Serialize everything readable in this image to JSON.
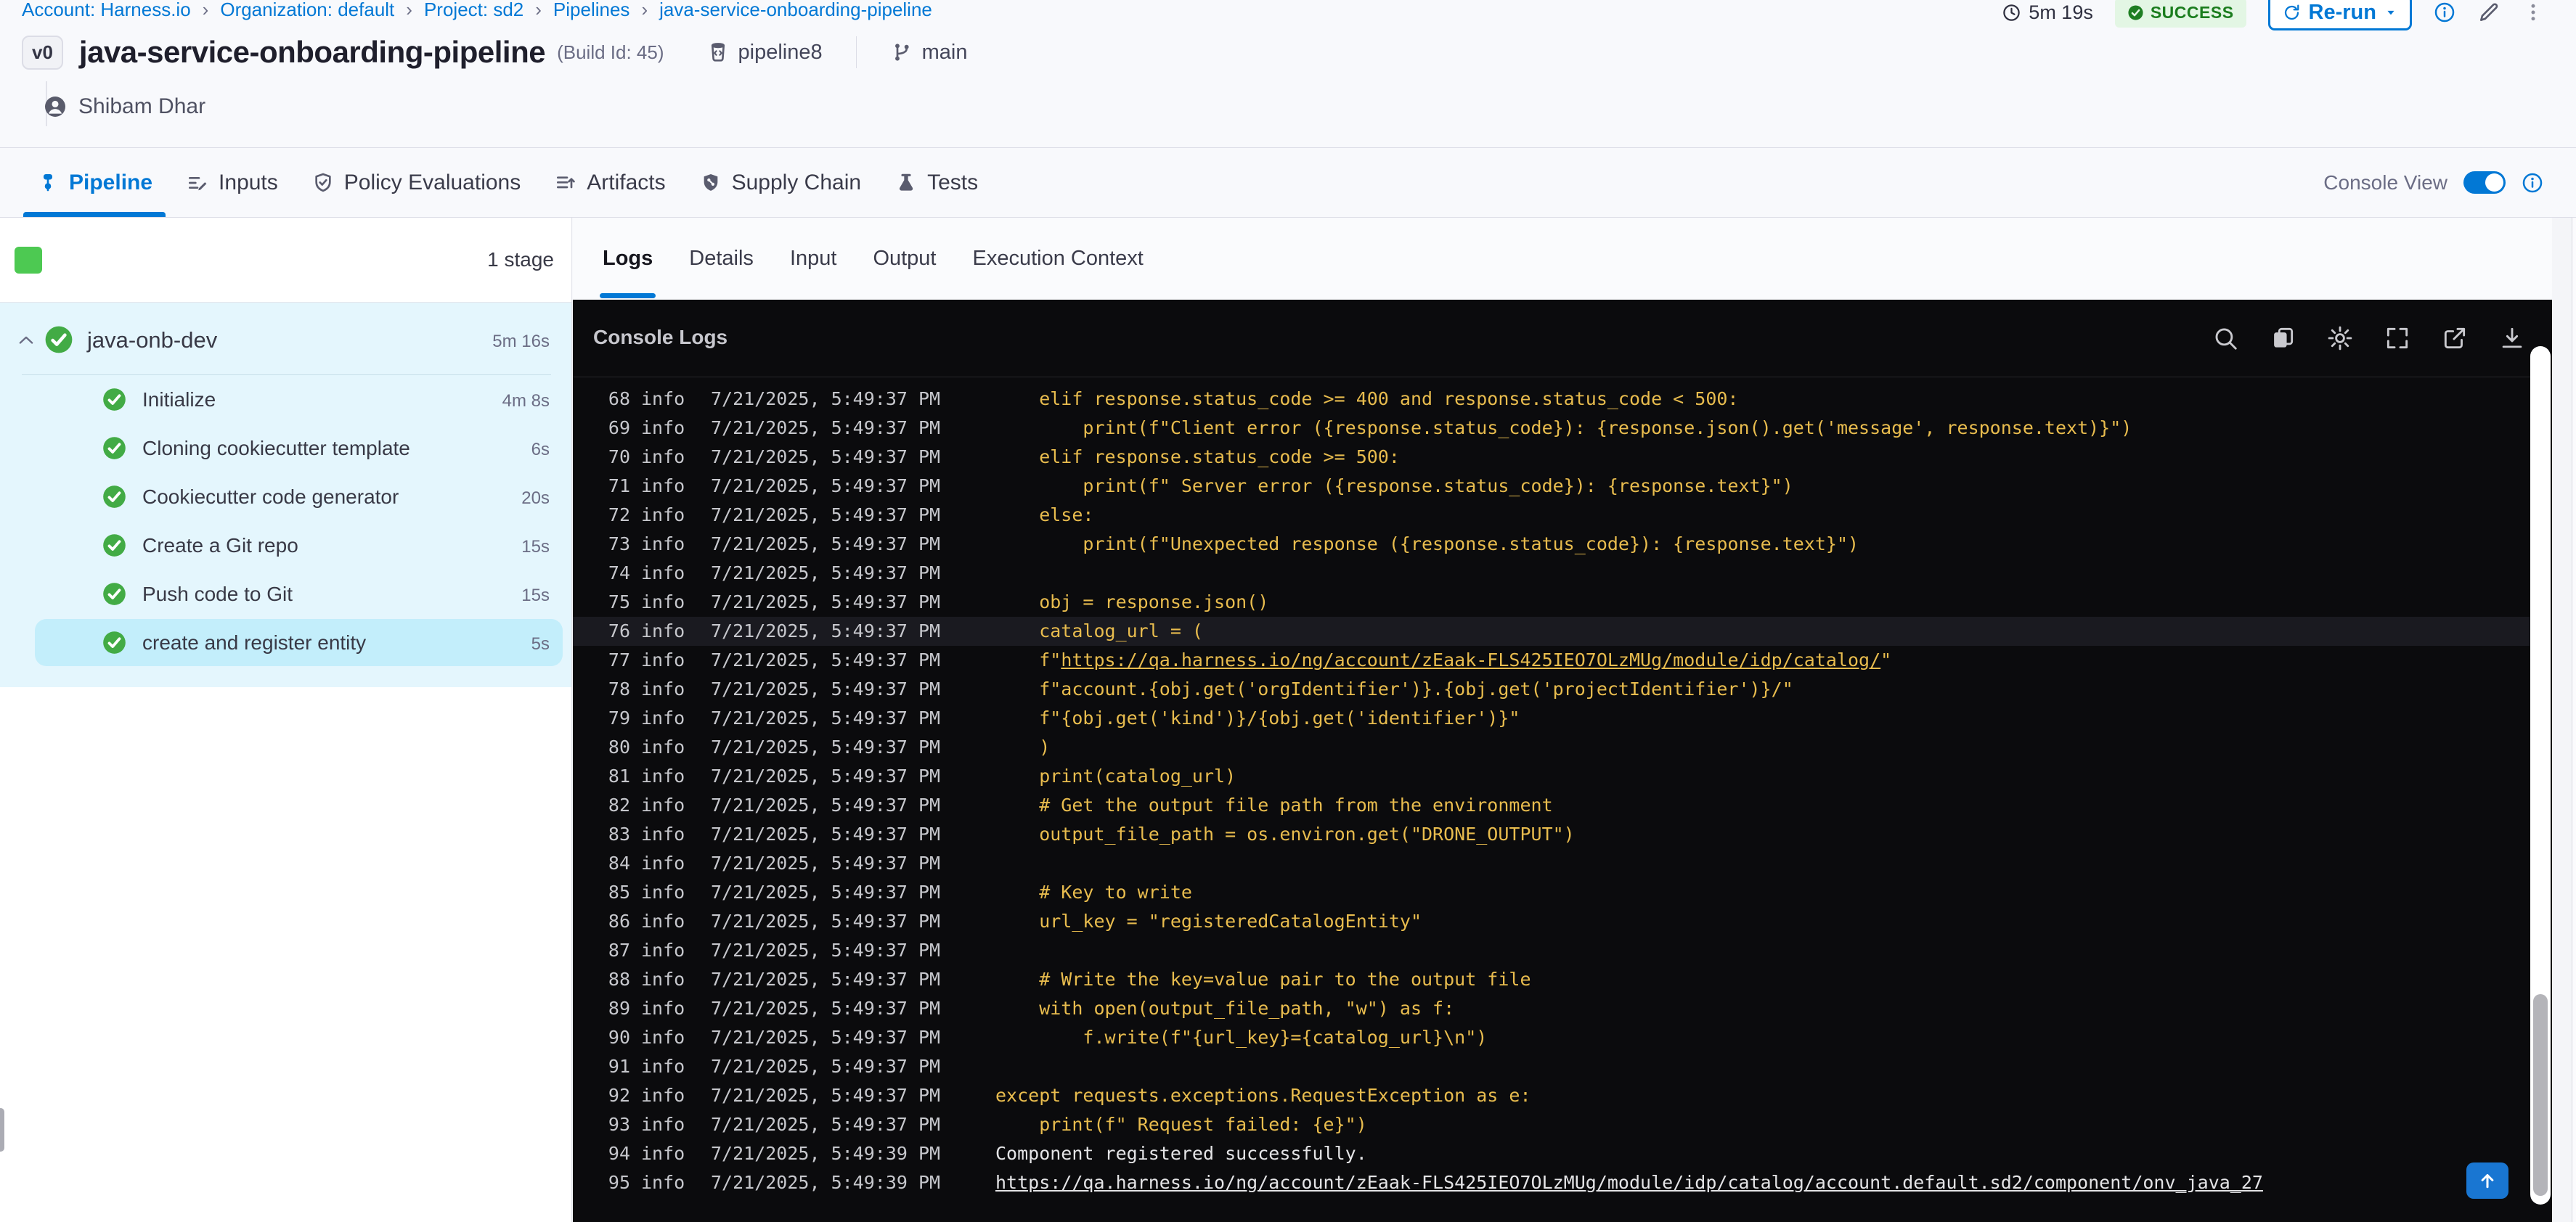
{
  "breadcrumb": {
    "items": [
      "Account: Harness.io",
      "Organization: default",
      "Project: sd2",
      "Pipelines",
      "java-service-onboarding-pipeline"
    ]
  },
  "run_meta": {
    "duration": "5m 19s",
    "status": "SUCCESS",
    "rerun_label": "Re-run"
  },
  "pipeline_header": {
    "version_chip": "v0",
    "title": "java-service-onboarding-pipeline",
    "build_label": "(Build Id: 45)",
    "repo": "pipeline8",
    "branch": "main",
    "user": "Shibam Dhar"
  },
  "nav_tabs": [
    {
      "label": "Pipeline",
      "icon": "pipeline-icon",
      "active": true
    },
    {
      "label": "Inputs",
      "icon": "inputs-icon",
      "active": false
    },
    {
      "label": "Policy Evaluations",
      "icon": "policy-icon",
      "active": false
    },
    {
      "label": "Artifacts",
      "icon": "artifacts-icon",
      "active": false
    },
    {
      "label": "Supply Chain",
      "icon": "supply-chain-icon",
      "active": false
    },
    {
      "label": "Tests",
      "icon": "tests-icon",
      "active": false
    }
  ],
  "console_view": {
    "label": "Console View",
    "enabled": true
  },
  "stage_panel": {
    "count_label": "1 stage",
    "stage": {
      "name": "java-onb-dev",
      "duration": "5m 16s"
    },
    "steps": [
      {
        "name": "Initialize",
        "duration": "4m 8s",
        "selected": false
      },
      {
        "name": "Cloning cookiecutter template",
        "duration": "6s",
        "selected": false
      },
      {
        "name": "Cookiecutter code generator",
        "duration": "20s",
        "selected": false
      },
      {
        "name": "Create a Git repo",
        "duration": "15s",
        "selected": false
      },
      {
        "name": "Push code to Git",
        "duration": "15s",
        "selected": false
      },
      {
        "name": "create and register entity",
        "duration": "5s",
        "selected": true
      }
    ]
  },
  "detail_tabs": [
    {
      "label": "Logs",
      "active": true
    },
    {
      "label": "Details",
      "active": false
    },
    {
      "label": "Input",
      "active": false
    },
    {
      "label": "Output",
      "active": false
    },
    {
      "label": "Execution Context",
      "active": false
    }
  ],
  "console": {
    "title": "Console Logs",
    "toolbar": [
      "search",
      "copy",
      "settings",
      "fullscreen",
      "open-in-new",
      "download"
    ],
    "lines": [
      {
        "n": 68,
        "level": "info",
        "ts": "7/21/2025, 5:49:37 PM",
        "style": "code",
        "text": "    elif response.status_code >= 400 and response.status_code < 500:"
      },
      {
        "n": 69,
        "level": "info",
        "ts": "7/21/2025, 5:49:37 PM",
        "style": "code",
        "text": "        print(f\"Client error ({response.status_code}): {response.json().get('message', response.text)}\")"
      },
      {
        "n": 70,
        "level": "info",
        "ts": "7/21/2025, 5:49:37 PM",
        "style": "code",
        "text": "    elif response.status_code >= 500:"
      },
      {
        "n": 71,
        "level": "info",
        "ts": "7/21/2025, 5:49:37 PM",
        "style": "code",
        "text": "        print(f\" Server error ({response.status_code}): {response.text}\")"
      },
      {
        "n": 72,
        "level": "info",
        "ts": "7/21/2025, 5:49:37 PM",
        "style": "code",
        "text": "    else:"
      },
      {
        "n": 73,
        "level": "info",
        "ts": "7/21/2025, 5:49:37 PM",
        "style": "code",
        "text": "        print(f\"Unexpected response ({response.status_code}): {response.text}\")"
      },
      {
        "n": 74,
        "level": "info",
        "ts": "7/21/2025, 5:49:37 PM",
        "style": "code",
        "text": ""
      },
      {
        "n": 75,
        "level": "info",
        "ts": "7/21/2025, 5:49:37 PM",
        "style": "code",
        "text": "    obj = response.json()"
      },
      {
        "n": 76,
        "level": "info",
        "ts": "7/21/2025, 5:49:37 PM",
        "style": "code",
        "text": "    catalog_url = (",
        "highlight": true
      },
      {
        "n": 77,
        "level": "info",
        "ts": "7/21/2025, 5:49:37 PM",
        "style": "code",
        "text": "    f\"",
        "link": "https://qa.harness.io/ng/account/zEaak-FLS425IEO7OLzMUg/module/idp/catalog/",
        "tail": "\""
      },
      {
        "n": 78,
        "level": "info",
        "ts": "7/21/2025, 5:49:37 PM",
        "style": "code",
        "text": "    f\"account.{obj.get('orgIdentifier')}.{obj.get('projectIdentifier')}/\""
      },
      {
        "n": 79,
        "level": "info",
        "ts": "7/21/2025, 5:49:37 PM",
        "style": "code",
        "text": "    f\"{obj.get('kind')}/{obj.get('identifier')}\""
      },
      {
        "n": 80,
        "level": "info",
        "ts": "7/21/2025, 5:49:37 PM",
        "style": "code",
        "text": "    )"
      },
      {
        "n": 81,
        "level": "info",
        "ts": "7/21/2025, 5:49:37 PM",
        "style": "code",
        "text": "    print(catalog_url)"
      },
      {
        "n": 82,
        "level": "info",
        "ts": "7/21/2025, 5:49:37 PM",
        "style": "code",
        "text": "    # Get the output file path from the environment"
      },
      {
        "n": 83,
        "level": "info",
        "ts": "7/21/2025, 5:49:37 PM",
        "style": "code",
        "text": "    output_file_path = os.environ.get(\"DRONE_OUTPUT\")"
      },
      {
        "n": 84,
        "level": "info",
        "ts": "7/21/2025, 5:49:37 PM",
        "style": "code",
        "text": ""
      },
      {
        "n": 85,
        "level": "info",
        "ts": "7/21/2025, 5:49:37 PM",
        "style": "code",
        "text": "    # Key to write"
      },
      {
        "n": 86,
        "level": "info",
        "ts": "7/21/2025, 5:49:37 PM",
        "style": "code",
        "text": "    url_key = \"registeredCatalogEntity\""
      },
      {
        "n": 87,
        "level": "info",
        "ts": "7/21/2025, 5:49:37 PM",
        "style": "code",
        "text": ""
      },
      {
        "n": 88,
        "level": "info",
        "ts": "7/21/2025, 5:49:37 PM",
        "style": "code",
        "text": "    # Write the key=value pair to the output file"
      },
      {
        "n": 89,
        "level": "info",
        "ts": "7/21/2025, 5:49:37 PM",
        "style": "code",
        "text": "    with open(output_file_path, \"w\") as f:"
      },
      {
        "n": 90,
        "level": "info",
        "ts": "7/21/2025, 5:49:37 PM",
        "style": "code",
        "text": "        f.write(f\"{url_key}={catalog_url}\\n\")"
      },
      {
        "n": 91,
        "level": "info",
        "ts": "7/21/2025, 5:49:37 PM",
        "style": "code",
        "text": ""
      },
      {
        "n": 92,
        "level": "info",
        "ts": "7/21/2025, 5:49:37 PM",
        "style": "code",
        "text": "except requests.exceptions.RequestException as e:"
      },
      {
        "n": 93,
        "level": "info",
        "ts": "7/21/2025, 5:49:37 PM",
        "style": "code",
        "text": "    print(f\" Request failed: {e}\")"
      },
      {
        "n": 94,
        "level": "info",
        "ts": "7/21/2025, 5:49:39 PM",
        "style": "plain",
        "text": "Component registered successfully."
      },
      {
        "n": 95,
        "level": "info",
        "ts": "7/21/2025, 5:49:39 PM",
        "style": "plain",
        "text": "",
        "link": "https://qa.harness.io/ng/account/zEaak-FLS425IEO7OLzMUg/module/idp/catalog/account.default.sd2/component/onv_java_27"
      }
    ]
  },
  "colors": {
    "accent_blue": "#0278D5",
    "success_green": "#42AB45",
    "stage_bg_blue": "#E4F6FD",
    "selected_step_bg": "#C3EEFB",
    "console_bg": "#0B0B0D",
    "log_yellow": "#E8BC4E",
    "log_white": "#E4E4E6"
  }
}
